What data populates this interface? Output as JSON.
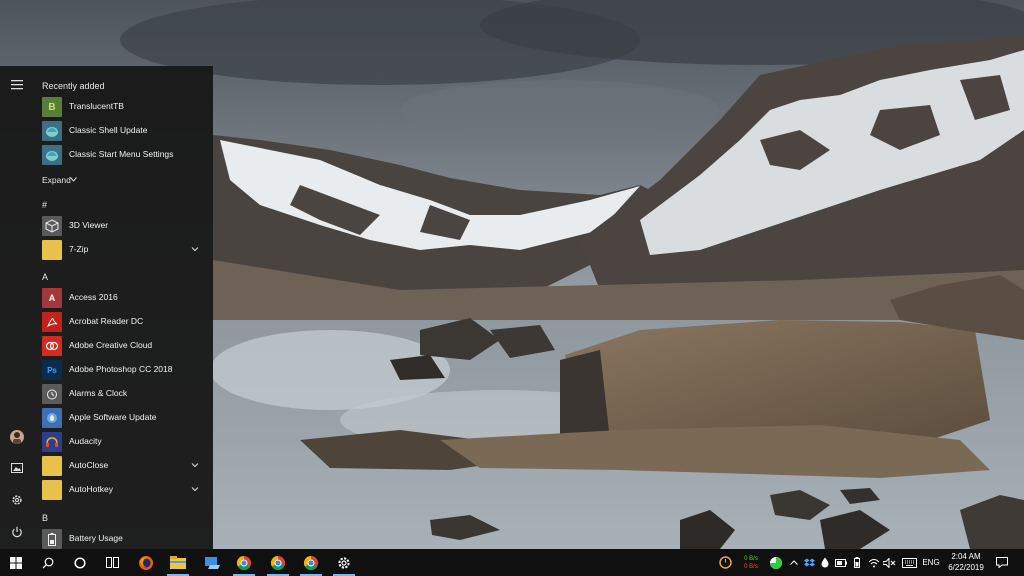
{
  "start_menu": {
    "recently_added_header": "Recently added",
    "recent": [
      {
        "label": "TranslucentTB",
        "icon": "translucenttb-icon",
        "color": "#5a7d3a"
      },
      {
        "label": "Classic Shell Update",
        "icon": "classic-shell-icon",
        "color": "#3d6f86"
      },
      {
        "label": "Classic Start Menu Settings",
        "icon": "classic-start-icon",
        "color": "#3d6f86"
      }
    ],
    "expand_label": "Expand",
    "sections": {
      "hash": "#",
      "a": "A",
      "b": "B"
    },
    "apps_hash": [
      {
        "label": "3D Viewer",
        "icon": "cube-icon",
        "color": "#5a5a5a",
        "expandable": false
      },
      {
        "label": "7-Zip",
        "icon": "folder-icon",
        "color": "#e8c14a",
        "expandable": true
      }
    ],
    "apps_a": [
      {
        "label": "Access 2016",
        "icon": "access-icon",
        "color": "#a4373a",
        "glyph": "A",
        "expandable": false
      },
      {
        "label": "Acrobat Reader DC",
        "icon": "acrobat-icon",
        "color": "#c3221c",
        "expandable": false
      },
      {
        "label": "Adobe Creative Cloud",
        "icon": "creative-cloud-icon",
        "color": "#d12c1f",
        "expandable": false
      },
      {
        "label": "Adobe Photoshop CC 2018",
        "icon": "photoshop-icon",
        "color": "#0c2c4e",
        "glyph": "Ps",
        "expandable": false
      },
      {
        "label": "Alarms & Clock",
        "icon": "alarm-clock-icon",
        "color": "#5a5a5a",
        "expandable": false
      },
      {
        "label": "Apple Software Update",
        "icon": "apple-update-icon",
        "color": "#3e6fb0",
        "expandable": false
      },
      {
        "label": "Audacity",
        "icon": "audacity-icon",
        "color": "#2d3f8c",
        "expandable": false
      },
      {
        "label": "AutoClose",
        "icon": "folder-icon",
        "color": "#e8c14a",
        "expandable": true
      },
      {
        "label": "AutoHotkey",
        "icon": "folder-icon",
        "color": "#e8c14a",
        "expandable": true
      }
    ],
    "apps_b": [
      {
        "label": "Battery Usage",
        "icon": "battery-usage-icon",
        "color": "#5a5a5a",
        "expandable": false
      }
    ],
    "rail": [
      "hamburger-menu-icon",
      "user-avatar",
      "pictures-icon",
      "settings-gear-icon",
      "power-icon"
    ]
  },
  "taskbar": {
    "pinned": [
      "windows-start-icon",
      "search-icon",
      "cortana-icon",
      "task-view-icon",
      "firefox-icon",
      "file-explorer-icon",
      "network-share-icon",
      "chrome-icon",
      "chrome-canary-icon",
      "chrome-alt-icon",
      "settings-gear-icon"
    ],
    "tray": {
      "net_up": "0 B/s",
      "net_down": "0 B/s",
      "language": "ENG",
      "time": "2:04 AM",
      "date": "6/22/2019"
    }
  },
  "colors": {
    "accent": "#76b9ed",
    "menu_bg": "#181818",
    "taskbar_bg": "#101010",
    "net_up_color": "#4ad04a",
    "net_down_color": "#e84a4a"
  }
}
